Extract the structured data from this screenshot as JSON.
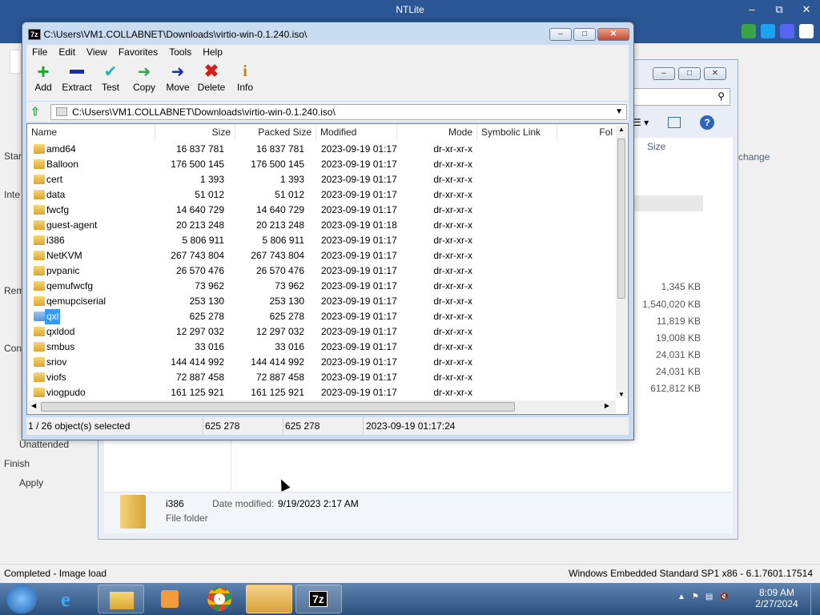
{
  "ntlite": {
    "title": "NTLite",
    "left_items": [
      "Star",
      "Inte",
      "Rem",
      "Con",
      "Unattended",
      "Finish",
      "Apply"
    ],
    "status_left": "Completed - Image load",
    "status_right": "Windows Embedded Standard SP1 x86 - 6.1.7601.17514"
  },
  "explorer": {
    "size_header": "Size",
    "change_fragment": "change",
    "sizes": [
      "1,345 KB",
      "1,540,020 KB",
      "11,819 KB",
      "19,008 KB",
      "24,031 KB",
      "24,031 KB",
      "612,812 KB"
    ],
    "details": {
      "name": "i386",
      "date_label": "Date modified:",
      "date": "9/19/2023 2:17 AM",
      "type": "File folder"
    }
  },
  "sevenzip": {
    "title": "C:\\Users\\VM1.COLLABNET\\Downloads\\virtio-win-0.1.240.iso\\",
    "menu": [
      "File",
      "Edit",
      "View",
      "Favorites",
      "Tools",
      "Help"
    ],
    "toolbar": [
      "Add",
      "Extract",
      "Test",
      "Copy",
      "Move",
      "Delete",
      "Info"
    ],
    "address": "C:\\Users\\VM1.COLLABNET\\Downloads\\virtio-win-0.1.240.iso\\",
    "columns": [
      "Name",
      "Size",
      "Packed Size",
      "Modified",
      "Mode",
      "Symbolic Link",
      "Fol"
    ],
    "rows": [
      {
        "name": "amd64",
        "size": "16 837 781",
        "packed": "16 837 781",
        "modified": "2023-09-19 01:17",
        "mode": "dr-xr-xr-x"
      },
      {
        "name": "Balloon",
        "size": "176 500 145",
        "packed": "176 500 145",
        "modified": "2023-09-19 01:17",
        "mode": "dr-xr-xr-x"
      },
      {
        "name": "cert",
        "size": "1 393",
        "packed": "1 393",
        "modified": "2023-09-19 01:17",
        "mode": "dr-xr-xr-x"
      },
      {
        "name": "data",
        "size": "51 012",
        "packed": "51 012",
        "modified": "2023-09-19 01:17",
        "mode": "dr-xr-xr-x"
      },
      {
        "name": "fwcfg",
        "size": "14 640 729",
        "packed": "14 640 729",
        "modified": "2023-09-19 01:17",
        "mode": "dr-xr-xr-x"
      },
      {
        "name": "guest-agent",
        "size": "20 213 248",
        "packed": "20 213 248",
        "modified": "2023-09-19 01:18",
        "mode": "dr-xr-xr-x"
      },
      {
        "name": "i386",
        "size": "5 806 911",
        "packed": "5 806 911",
        "modified": "2023-09-19 01:17",
        "mode": "dr-xr-xr-x"
      },
      {
        "name": "NetKVM",
        "size": "267 743 804",
        "packed": "267 743 804",
        "modified": "2023-09-19 01:17",
        "mode": "dr-xr-xr-x"
      },
      {
        "name": "pvpanic",
        "size": "26 570 476",
        "packed": "26 570 476",
        "modified": "2023-09-19 01:17",
        "mode": "dr-xr-xr-x"
      },
      {
        "name": "qemufwcfg",
        "size": "73 962",
        "packed": "73 962",
        "modified": "2023-09-19 01:17",
        "mode": "dr-xr-xr-x"
      },
      {
        "name": "qemupciserial",
        "size": "253 130",
        "packed": "253 130",
        "modified": "2023-09-19 01:17",
        "mode": "dr-xr-xr-x"
      },
      {
        "name": "qxl",
        "size": "625 278",
        "packed": "625 278",
        "modified": "2023-09-19 01:17",
        "mode": "dr-xr-xr-x",
        "selected": true
      },
      {
        "name": "qxldod",
        "size": "12 297 032",
        "packed": "12 297 032",
        "modified": "2023-09-19 01:17",
        "mode": "dr-xr-xr-x"
      },
      {
        "name": "smbus",
        "size": "33 016",
        "packed": "33 016",
        "modified": "2023-09-19 01:17",
        "mode": "dr-xr-xr-x"
      },
      {
        "name": "sriov",
        "size": "144 414 992",
        "packed": "144 414 992",
        "modified": "2023-09-19 01:17",
        "mode": "dr-xr-xr-x"
      },
      {
        "name": "viofs",
        "size": "72 887 458",
        "packed": "72 887 458",
        "modified": "2023-09-19 01:17",
        "mode": "dr-xr-xr-x"
      },
      {
        "name": "viogpudo",
        "size": "161 125 921",
        "packed": "161 125 921",
        "modified": "2023-09-19 01:17",
        "mode": "dr-xr-xr-x"
      }
    ],
    "status": {
      "selected": "1 / 26 object(s) selected",
      "size": "625 278",
      "packed": "625 278",
      "modified": "2023-09-19 01:17:24"
    }
  },
  "taskbar": {
    "time": "8:09 AM",
    "date": "2/27/2024"
  }
}
